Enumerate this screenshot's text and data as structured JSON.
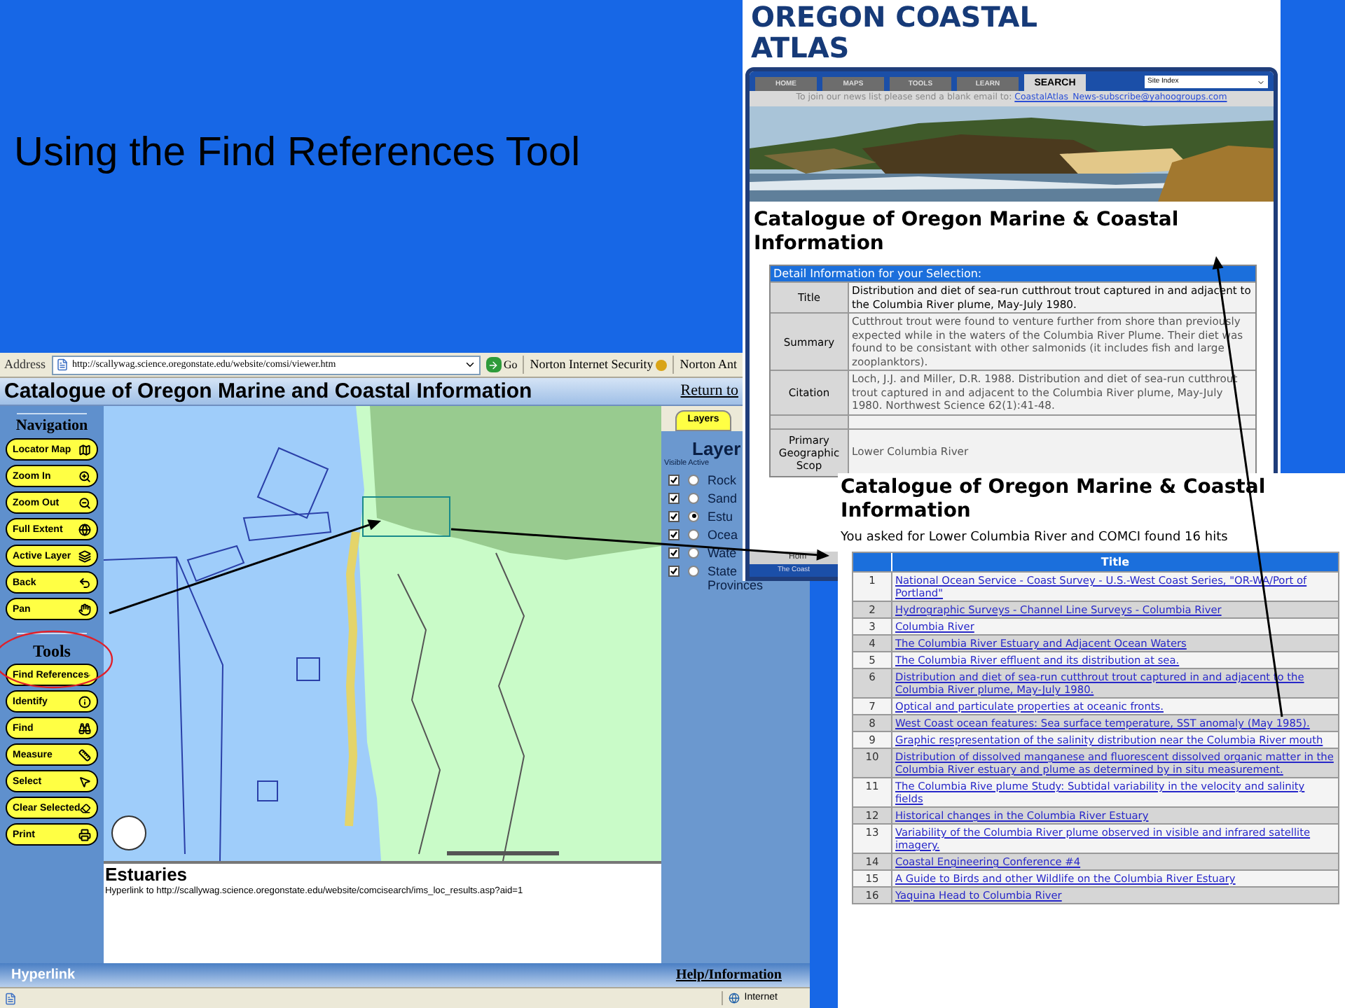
{
  "slide": {
    "title": "Using the Find References Tool"
  },
  "viewer": {
    "address_bar": {
      "label": "Address",
      "url": "http://scallywag.science.oregonstate.edu/website/comsi/viewer.htm",
      "go": "Go",
      "toolbar_items": [
        "Norton Internet Security",
        "Norton Ant"
      ]
    },
    "title": "Catalogue of Oregon Marine and Coastal Information",
    "return_link": "Return to",
    "navigation": {
      "heading": "Navigation",
      "buttons": [
        "Locator Map",
        "Zoom In",
        "Zoom Out",
        "Full Extent",
        "Active Layer",
        "Back",
        "Pan"
      ]
    },
    "tools": {
      "heading": "Tools",
      "buttons": [
        "Find References",
        "Identify",
        "Find",
        "Measure",
        "Select",
        "Clear Selected",
        "Print"
      ]
    },
    "layers_panel": {
      "tab": "Layers",
      "heading": "Layer",
      "columns": [
        "Visible",
        "Active"
      ],
      "layers": [
        {
          "name": "Rock",
          "visible": true,
          "active": false
        },
        {
          "name": "Sand",
          "visible": true,
          "active": false
        },
        {
          "name": "Estu",
          "visible": true,
          "active": true
        },
        {
          "name": "Ocea",
          "visible": true,
          "active": false
        },
        {
          "name": "Wate",
          "visible": true,
          "active": false
        },
        {
          "name": "State Provinces",
          "visible": true,
          "active": false
        }
      ]
    },
    "info": {
      "heading": "Estuaries",
      "text": "Hyperlink to http://scallywag.science.oregonstate.edu/website/comcisearch/ims_loc_results.asp?aid=1"
    },
    "footer": {
      "left": "Hyperlink",
      "right": "Help/Information"
    },
    "status_bar": {
      "zone": "Internet"
    }
  },
  "atlas": {
    "logo": "OREGON COASTAL ATLAS",
    "tabs": [
      {
        "label": "HOME",
        "selected": false
      },
      {
        "label": "MAPS",
        "selected": false
      },
      {
        "label": "TOOLS",
        "selected": false
      },
      {
        "label": "LEARN",
        "selected": false
      },
      {
        "label": "SEARCH",
        "selected": true
      }
    ],
    "site_index": "Site Index",
    "newsletter": "To join our news list please send a blank email to:",
    "email": "CoastalAtlas_News-subscribe@yahoogroups.com",
    "heading": "Catalogue of Oregon Marine & Coastal Information",
    "detail": {
      "header": "Detail Information for your Selection:",
      "rows": [
        {
          "kind": "title",
          "label": "Title",
          "value": "Distribution and diet of sea-run cutthrout trout captured in and adjacent to the Columbia River plume, May-July 1980."
        },
        {
          "kind": "text",
          "label": "Summary",
          "value": "Cutthrout trout were found to venture further from shore than previously expected while in the waters of the Columbia River Plume. Their diet was found to be consistant with other salmonids (it includes fish and large zooplanktors)."
        },
        {
          "kind": "text",
          "label": "Citation",
          "value": "Loch, J.J. and Miller, D.R. 1988. Distribution and diet of sea-run cutthrout trout captured in and adjacent to the Columbia River plume, May-July 1980. Northwest Science 62(1):41-48."
        },
        {
          "kind": "spacer"
        },
        {
          "kind": "text",
          "label": "Primary Geographic Scop",
          "value": "Lower Columbia River"
        }
      ]
    },
    "footer": [
      "Hom",
      "The Coast"
    ]
  },
  "results": {
    "heading": "Catalogue of Oregon Marine & Coastal Information",
    "summary": "You asked for Lower Columbia River and COMCI found 16 hits",
    "column": "Title",
    "rows": [
      {
        "number": "1",
        "title": "National Ocean Service - Coast Survey - U.S.-West Coast Series, \"OR-WA/Port of Portland\""
      },
      {
        "number": "2",
        "title": "Hydrographic Surveys - Channel Line Surveys - Columbia River"
      },
      {
        "number": "3",
        "title": "Columbia River"
      },
      {
        "number": "4",
        "title": "The Columbia River Estuary and Adjacent Ocean Waters"
      },
      {
        "number": "5",
        "title": "The Columbia River effluent and its distribution at sea."
      },
      {
        "number": "6",
        "title": "Distribution and diet of sea-run cutthrout trout captured in and adjacent to the Columbia River plume, May-July 1980."
      },
      {
        "number": "7",
        "title": "Optical and particulate properties at oceanic fronts."
      },
      {
        "number": "8",
        "title": "West Coast ocean features: Sea surface temperature, SST anomaly (May 1985)."
      },
      {
        "number": "9",
        "title": "Graphic respresentation of the salinity distribution near the Columbia River mouth"
      },
      {
        "number": "10",
        "title": "Distribution of dissolved manganese and fluorescent dissolved organic matter in the Columbia River estuary and plume as determined by in situ measurement."
      },
      {
        "number": "11",
        "title": "The Columbia Rive plume Study: Subtidal variability in the velocity and salinity fields"
      },
      {
        "number": "12",
        "title": "Historical changes in the Columbia River Estuary"
      },
      {
        "number": "13",
        "title": "Variability of the Columbia River plume observed in visible and infrared satellite imagery."
      },
      {
        "number": "14",
        "title": "Coastal Engineering Conference #4"
      },
      {
        "number": "15",
        "title": "A Guide to Birds and other Wildlife on the Columbia River Estuary"
      },
      {
        "number": "16",
        "title": "Yaquina Head to Columbia River"
      }
    ]
  }
}
